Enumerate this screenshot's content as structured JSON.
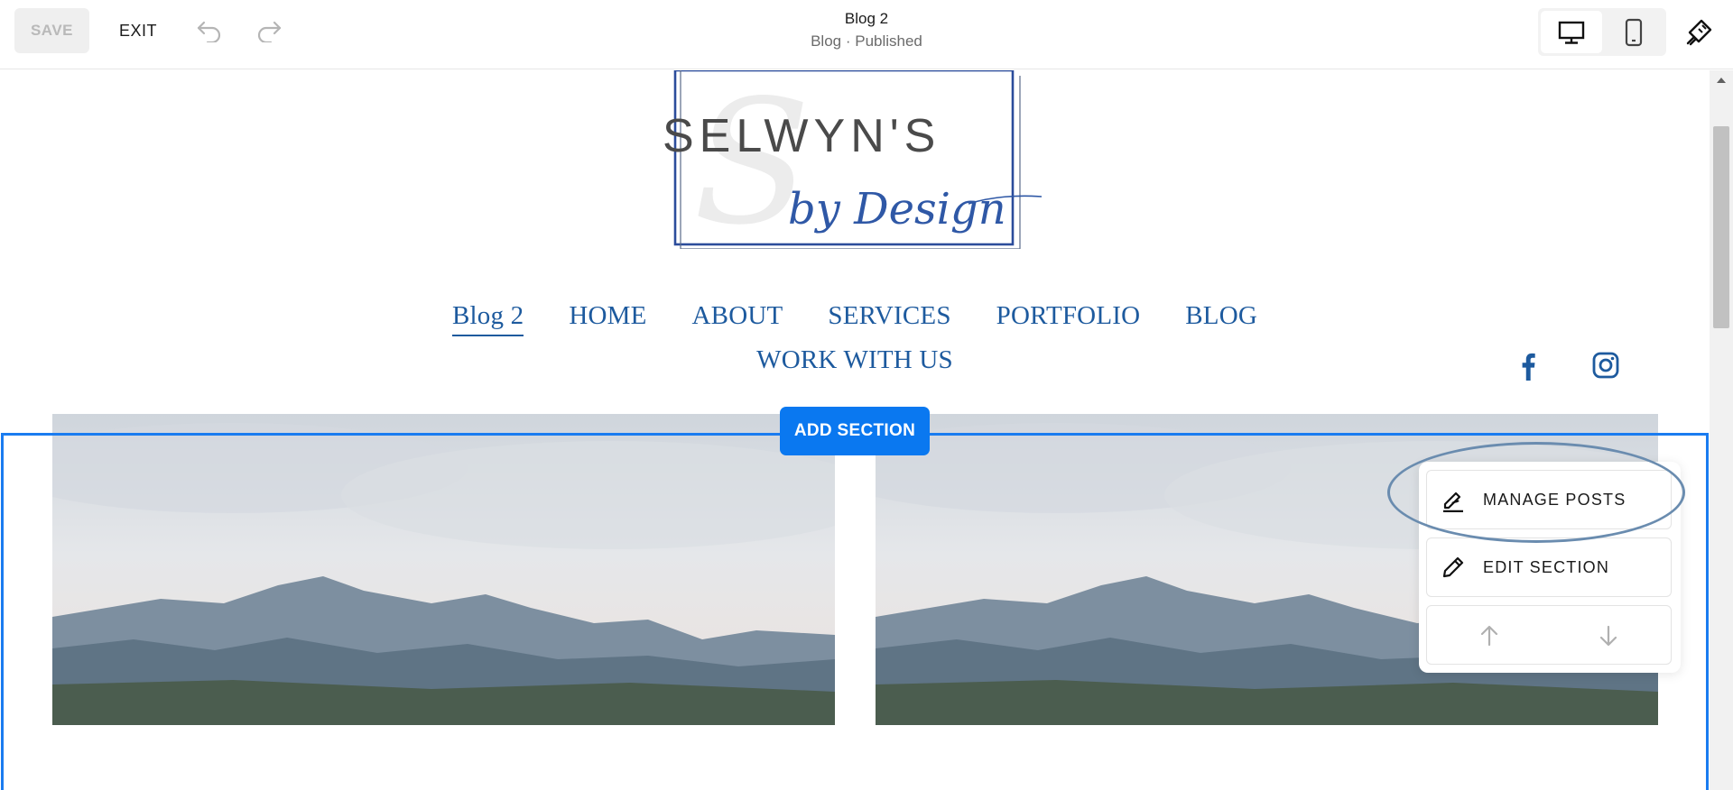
{
  "toolbar": {
    "save_label": "SAVE",
    "exit_label": "EXIT",
    "title": "Blog 2",
    "subtitle": "Blog · Published"
  },
  "site": {
    "logo_main": "SELWYN'S",
    "logo_script": "by Design",
    "logo_monogram": "S",
    "nav": {
      "row1": [
        "Blog 2",
        "HOME",
        "ABOUT",
        "SERVICES",
        "PORTFOLIO",
        "BLOG"
      ],
      "row2": [
        "WORK WITH US"
      ],
      "active": "Blog 2"
    },
    "social": [
      "facebook-icon",
      "instagram-icon"
    ]
  },
  "section": {
    "add_section_label": "ADD SECTION",
    "tools": {
      "manage_posts": "MANAGE POSTS",
      "edit_section": "EDIT SECTION"
    }
  },
  "colors": {
    "accent": "#0a78f0",
    "nav": "#1d5a9e",
    "highlight": "#6a8caf"
  }
}
